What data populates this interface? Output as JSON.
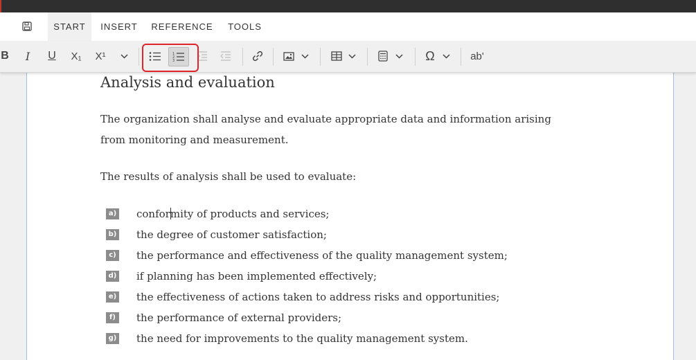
{
  "tabs": [
    {
      "label": "START",
      "active": true
    },
    {
      "label": "INSERT",
      "active": false
    },
    {
      "label": "REFERENCE",
      "active": false
    },
    {
      "label": "TOOLS",
      "active": false
    }
  ],
  "toolbar": {
    "bold": "B",
    "italic": "I",
    "underline": "U",
    "subscript": "X₁",
    "superscript": "X¹",
    "spellcheck": "ab'",
    "icons": [
      "bold-icon",
      "italic-icon",
      "underline-icon",
      "subscript-icon",
      "superscript-icon",
      "chevron-down-icon",
      "bulleted-list-icon",
      "numbered-list-icon",
      "increase-indent-icon",
      "decrease-indent-icon",
      "link-icon",
      "image-icon",
      "table-icon",
      "calculator-icon",
      "omega-icon",
      "spellcheck-icon"
    ]
  },
  "highlight_color": "#e0242a",
  "document": {
    "heading": "Analysis and evaluation",
    "para1": "The organization shall analyse and evaluate appropriate data and information arising from monitoring and measurement.",
    "para2": "The results of analysis shall be used to evaluate:",
    "list": [
      {
        "marker": "a)",
        "text_before_caret": "confor",
        "text_after_caret": "mity of products and services;"
      },
      {
        "marker": "b)",
        "text": "the degree of customer satisfaction;"
      },
      {
        "marker": "c)",
        "text": "the performance and effectiveness of the quality management system;"
      },
      {
        "marker": "d)",
        "text": "if planning has been implemented effectively;"
      },
      {
        "marker": "e)",
        "text": "the effectiveness of actions taken to address risks and opportunities;"
      },
      {
        "marker": "f)",
        "text": "the performance of external providers;"
      },
      {
        "marker": "g)",
        "text": "the need for improvements to the quality management system."
      }
    ]
  }
}
